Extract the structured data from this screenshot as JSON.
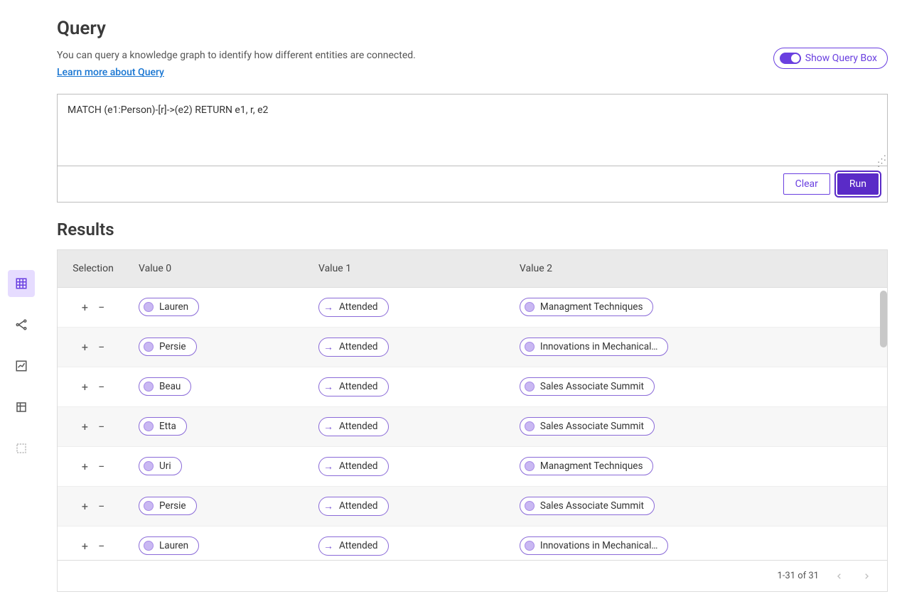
{
  "header": {
    "title": "Query",
    "subtitle": "You can query a knowledge graph to identify how different entities are connected.",
    "learn_more": "Learn more about Query",
    "toggle_label": "Show Query Box"
  },
  "query": {
    "value": "MATCH (e1:Person)-[r]->(e2) RETURN e1, r, e2",
    "clear_label": "Clear",
    "run_label": "Run"
  },
  "results": {
    "title": "Results",
    "columns": [
      "Selection",
      "Value 0",
      "Value 1",
      "Value 2"
    ],
    "rows": [
      {
        "v0": "Lauren",
        "v1": "Attended",
        "v2": "Managment Techniques"
      },
      {
        "v0": "Persie",
        "v1": "Attended",
        "v2": "Innovations in Mechanical…"
      },
      {
        "v0": "Beau",
        "v1": "Attended",
        "v2": "Sales Associate Summit"
      },
      {
        "v0": "Etta",
        "v1": "Attended",
        "v2": "Sales Associate Summit"
      },
      {
        "v0": "Uri",
        "v1": "Attended",
        "v2": "Managment Techniques"
      },
      {
        "v0": "Persie",
        "v1": "Attended",
        "v2": "Sales Associate Summit"
      },
      {
        "v0": "Lauren",
        "v1": "Attended",
        "v2": "Innovations in Mechanical…"
      }
    ],
    "pagination": "1-31 of 31"
  }
}
